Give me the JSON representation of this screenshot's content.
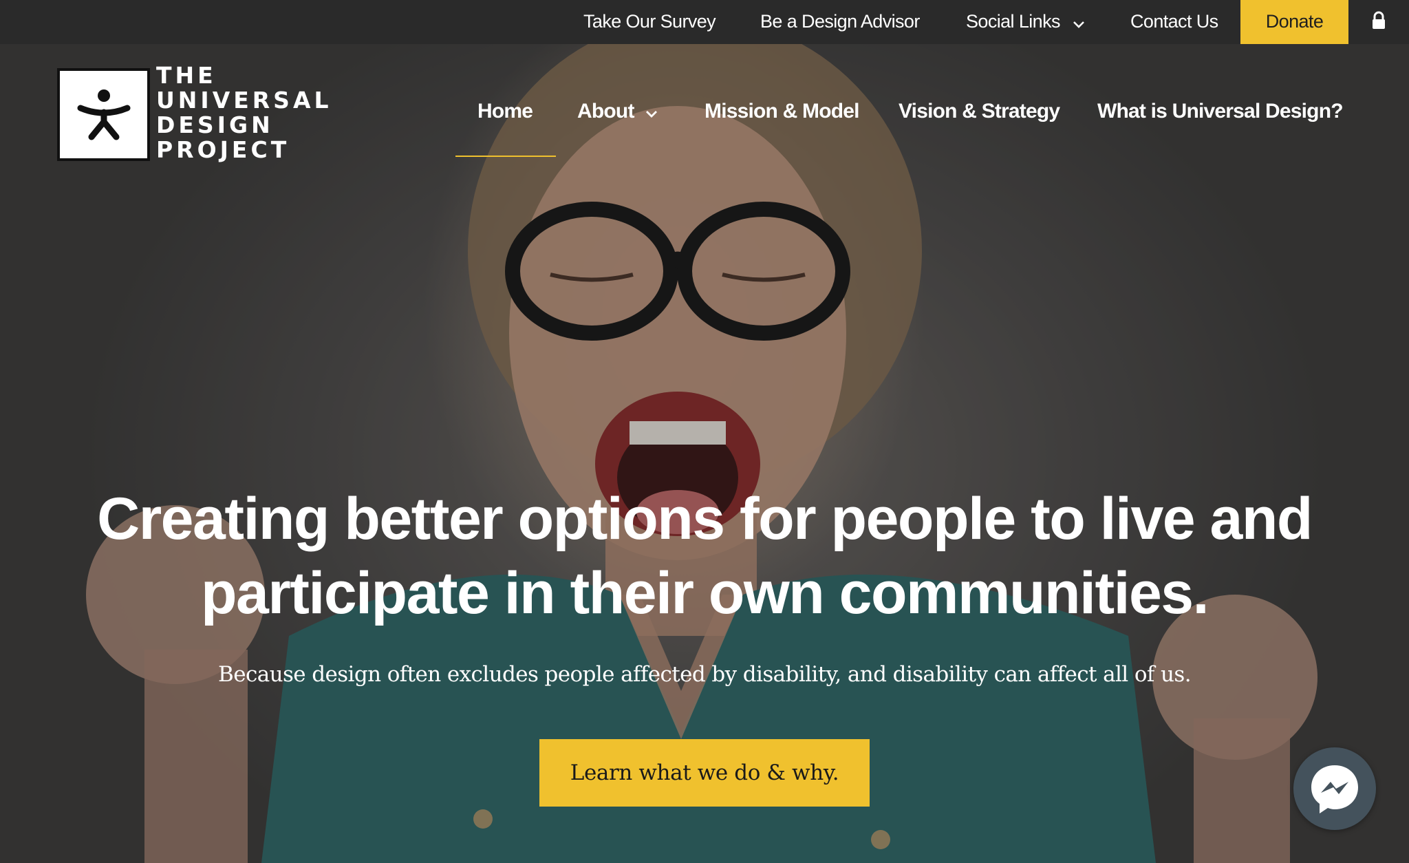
{
  "topbar": {
    "items": [
      {
        "label": "Take Our Survey"
      },
      {
        "label": "Be a Design Advisor"
      },
      {
        "label": "Social Links",
        "icon": "chevron-down-icon"
      },
      {
        "label": "Contact Us"
      }
    ],
    "donate_label": "Donate",
    "lock_icon": "lock-icon"
  },
  "logo": {
    "icon": "person-figure-icon",
    "lines": [
      "THE",
      "UNIVERSAL",
      "DESIGN",
      "PROJECT"
    ]
  },
  "nav": {
    "items": [
      {
        "label": "Home",
        "active": true
      },
      {
        "label": "About",
        "icon": "chevron-down-icon"
      },
      {
        "label": "Mission & Model"
      },
      {
        "label": "Vision & Strategy"
      },
      {
        "label": "What is Universal Design?"
      }
    ]
  },
  "hero": {
    "headline_line1": "Creating better options for people to live and",
    "headline_line2": "participate in their own communities.",
    "subline": "Because design often excludes people affected by disability, and disability can affect all of us.",
    "cta_label": "Learn what we do & why."
  },
  "chat": {
    "icon": "messenger-icon"
  },
  "colors": {
    "accent": "#f0c12e",
    "topbar_bg": "#2a2a2a",
    "text": "#ffffff",
    "messenger_bg": "#44525c"
  }
}
